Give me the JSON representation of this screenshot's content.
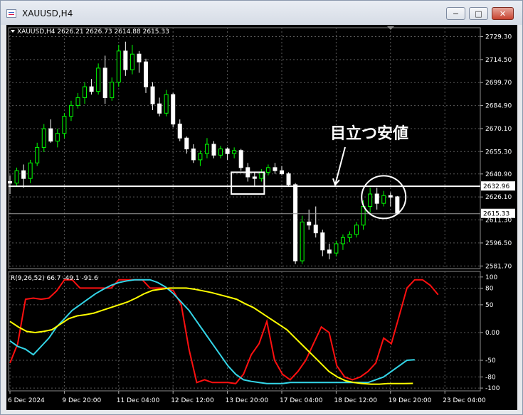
{
  "window": {
    "title": "XAUUSD,H4",
    "minimize_glyph": "−",
    "maximize_glyph": "□",
    "close_glyph": "✕"
  },
  "chart_data": [
    {
      "type": "candlestick",
      "symbol_header": "XAUUSD,H4  2626.21 2626.73 2614.88 2615.33",
      "y_tick_labels": [
        "2729.30",
        "2714.50",
        "2699.70",
        "2684.90",
        "2670.10",
        "2655.30",
        "2640.90",
        "2626.10",
        "2611.30",
        "2596.50",
        "2581.70"
      ],
      "y_ticks": [
        2729.3,
        2714.5,
        2699.7,
        2684.9,
        2670.1,
        2655.3,
        2640.9,
        2626.1,
        2611.3,
        2596.5,
        2581.7
      ],
      "ylim": [
        2580.0,
        2735.0
      ],
      "x_tick_labels": [
        "6 Dec 2024",
        "9 Dec 20:00",
        "11 Dec 04:00",
        "12 Dec 12:00",
        "13 Dec 20:00",
        "17 Dec 04:00",
        "18 Dec 12:00",
        "19 Dec 20:00",
        "23 Dec 04:00"
      ],
      "x_tick_bars": [
        0,
        8,
        16,
        24,
        32,
        40,
        48,
        56,
        64
      ],
      "horizontal_line": {
        "value": 2632.96,
        "label": "2632.96",
        "color": "#ffffff"
      },
      "current_price": {
        "value": 2615.33,
        "label": "2615.33"
      },
      "annotation": "目立つ安値",
      "grid": true,
      "up_color": "#00ff00",
      "down_color": "#ffffff",
      "candles": [
        [
          2636,
          2640,
          2628,
          2635
        ],
        [
          2635,
          2645,
          2633,
          2643
        ],
        [
          2643,
          2647,
          2632,
          2638
        ],
        [
          2638,
          2650,
          2635,
          2648
        ],
        [
          2648,
          2661,
          2646,
          2658
        ],
        [
          2658,
          2673,
          2655,
          2670
        ],
        [
          2670,
          2676,
          2661,
          2662
        ],
        [
          2662,
          2670,
          2658,
          2667
        ],
        [
          2667,
          2680,
          2664,
          2678
        ],
        [
          2678,
          2688,
          2675,
          2685
        ],
        [
          2685,
          2693,
          2683,
          2690
        ],
        [
          2690,
          2700,
          2686,
          2697
        ],
        [
          2697,
          2702,
          2692,
          2694
        ],
        [
          2694,
          2712,
          2692,
          2709
        ],
        [
          2709,
          2717,
          2686,
          2690
        ],
        [
          2690,
          2703,
          2688,
          2700
        ],
        [
          2700,
          2724,
          2697,
          2720
        ],
        [
          2720,
          2726,
          2704,
          2708
        ],
        [
          2708,
          2724,
          2705,
          2718
        ],
        [
          2718,
          2720,
          2706,
          2713
        ],
        [
          2713,
          2715,
          2693,
          2697
        ],
        [
          2697,
          2700,
          2682,
          2686
        ],
        [
          2686,
          2690,
          2678,
          2680
        ],
        [
          2680,
          2695,
          2678,
          2692
        ],
        [
          2692,
          2693,
          2671,
          2673
        ],
        [
          2673,
          2676,
          2662,
          2664
        ],
        [
          2664,
          2665,
          2654,
          2657
        ],
        [
          2657,
          2660,
          2648,
          2650
        ],
        [
          2650,
          2656,
          2646,
          2654
        ],
        [
          2654,
          2664,
          2651,
          2660
        ],
        [
          2660,
          2662,
          2651,
          2653
        ],
        [
          2653,
          2659,
          2651,
          2657
        ],
        [
          2657,
          2658,
          2650,
          2654
        ],
        [
          2654,
          2658,
          2651,
          2656
        ],
        [
          2656,
          2657,
          2643,
          2645
        ],
        [
          2645,
          2648,
          2636,
          2639
        ],
        [
          2639,
          2642,
          2633,
          2638
        ],
        [
          2638,
          2644,
          2636,
          2642
        ],
        [
          2642,
          2647,
          2640,
          2645
        ],
        [
          2645,
          2648,
          2641,
          2643
        ],
        [
          2643,
          2646,
          2640,
          2641
        ],
        [
          2641,
          2642,
          2633,
          2634
        ],
        [
          2634,
          2635,
          2583,
          2585
        ],
        [
          2585,
          2614,
          2583,
          2610
        ],
        [
          2610,
          2618,
          2605,
          2608
        ],
        [
          2608,
          2620,
          2600,
          2603
        ],
        [
          2603,
          2605,
          2588,
          2592
        ],
        [
          2592,
          2596,
          2586,
          2590
        ],
        [
          2590,
          2598,
          2588,
          2596
        ],
        [
          2596,
          2602,
          2592,
          2600
        ],
        [
          2600,
          2604,
          2597,
          2602
        ],
        [
          2602,
          2610,
          2600,
          2608
        ],
        [
          2608,
          2624,
          2605,
          2620
        ],
        [
          2620,
          2632,
          2616,
          2628
        ],
        [
          2628,
          2632,
          2618,
          2622
        ],
        [
          2622,
          2630,
          2620,
          2627
        ],
        [
          2627,
          2629,
          2620,
          2626
        ],
        [
          2626.21,
          2626.73,
          2614.88,
          2615.33
        ]
      ]
    },
    {
      "type": "line",
      "header": "R(9,26,52) 66.7 -49.1 -91.6",
      "y_tick_labels": [
        "100",
        "80",
        "50",
        "0.00",
        "-50",
        "-80",
        "-100"
      ],
      "y_ticks": [
        100,
        80,
        50,
        0,
        -50,
        -80,
        -100
      ],
      "ylim": [
        -105,
        110
      ],
      "grid": true,
      "series": [
        {
          "color": "#ff1010",
          "values": [
            -55,
            -20,
            60,
            62,
            60,
            62,
            75,
            95,
            95,
            80,
            80,
            80,
            80,
            80,
            95,
            95,
            95,
            95,
            80,
            80,
            80,
            75,
            50,
            -30,
            -90,
            -85,
            -90,
            -90,
            -90,
            -92,
            -75,
            -40,
            -20,
            20,
            -50,
            -75,
            -85,
            -70,
            -50,
            -20,
            10,
            0,
            -60,
            -80,
            -85,
            -80,
            -70,
            -55,
            -10,
            -20,
            30,
            80,
            95,
            95,
            85,
            68
          ]
        },
        {
          "color": "#34d6e8",
          "values": [
            -15,
            -25,
            -30,
            -40,
            -25,
            -10,
            10,
            25,
            40,
            50,
            60,
            70,
            78,
            85,
            90,
            93,
            95,
            95,
            95,
            90,
            82,
            70,
            55,
            40,
            20,
            0,
            -20,
            -40,
            -60,
            -75,
            -85,
            -88,
            -90,
            -92,
            -92,
            -92,
            -90,
            -90,
            -90,
            -90,
            -90,
            -90,
            -90,
            -90,
            -90,
            -90,
            -90,
            -85,
            -80,
            -70,
            -60,
            -50,
            -49
          ]
        },
        {
          "color": "#ffff00",
          "values": [
            20,
            10,
            2,
            0,
            2,
            5,
            15,
            25,
            30,
            32,
            35,
            40,
            45,
            50,
            55,
            62,
            70,
            76,
            78,
            80,
            80,
            80,
            78,
            75,
            72,
            68,
            64,
            60,
            52,
            45,
            35,
            25,
            15,
            5,
            -10,
            -25,
            -40,
            -55,
            -70,
            -80,
            -87,
            -90,
            -92,
            -93,
            -93,
            -92,
            -92,
            -92,
            -91.6
          ]
        }
      ]
    }
  ]
}
